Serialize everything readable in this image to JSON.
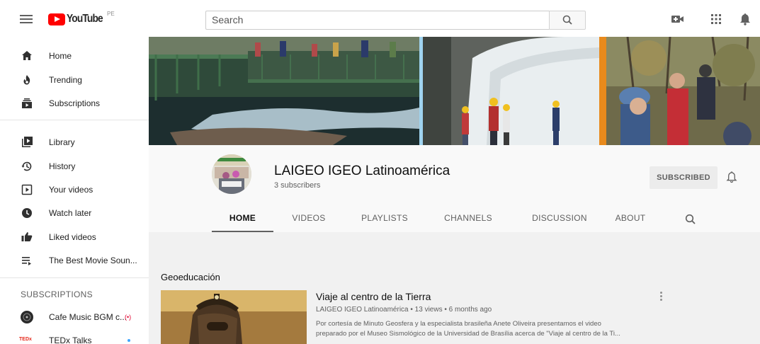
{
  "header": {
    "logo_text": "YouTube",
    "region": "PE",
    "search_placeholder": "Search",
    "icons": [
      "menu-icon",
      "create-video-icon",
      "apps-grid-icon",
      "notifications-bell-icon"
    ]
  },
  "sidebar": {
    "main": [
      {
        "label": "Home",
        "icon": "home-icon"
      },
      {
        "label": "Trending",
        "icon": "trending-flame-icon"
      },
      {
        "label": "Subscriptions",
        "icon": "subscriptions-icon"
      }
    ],
    "library": [
      {
        "label": "Library",
        "icon": "library-icon"
      },
      {
        "label": "History",
        "icon": "history-icon"
      },
      {
        "label": "Your videos",
        "icon": "your-videos-icon"
      },
      {
        "label": "Watch later",
        "icon": "watch-later-icon"
      },
      {
        "label": "Liked videos",
        "icon": "thumbs-up-icon"
      },
      {
        "label": "The Best Movie Soun...",
        "icon": "playlist-icon"
      }
    ],
    "subscriptions_title": "SUBSCRIPTIONS",
    "subscriptions": [
      {
        "label": "Cafe Music BGM c...",
        "status": "live",
        "live_glyph": "(•)"
      },
      {
        "label": "TEDx Talks",
        "status": "new",
        "avatar_text": "TEDx"
      }
    ]
  },
  "channel": {
    "name": "LAIGEO IGEO Latinoamérica",
    "subscribers": "3 subscribers",
    "subscribe_button": "SUBSCRIBED",
    "tabs": [
      "HOME",
      "VIDEOS",
      "PLAYLISTS",
      "CHANNELS",
      "DISCUSSION",
      "ABOUT"
    ],
    "active_tab": "HOME"
  },
  "content": {
    "section_title": "Geoeducación",
    "video": {
      "title": "Viaje al centro de la Tierra",
      "meta": "LAIGEO IGEO Latinoamérica • 13 views • 6 months ago",
      "description_lines": [
        "Por cortesía de Minuto Geosfera y la especialista brasileña Anete Oliveira presentamos el video",
        "preparado por el Museo Sismológico de la Universidad de Brasília acerca de \"Viaje al centro de la Ti..."
      ]
    }
  },
  "colors": {
    "brand_red": "#ff0000",
    "sidebar_bg": "#ffffff",
    "header_bg": "#f9f9f9",
    "content_bg": "#f1f1f1",
    "banner_separator_blue": "#9fd3ef",
    "banner_separator_orange": "#e88a1c"
  }
}
